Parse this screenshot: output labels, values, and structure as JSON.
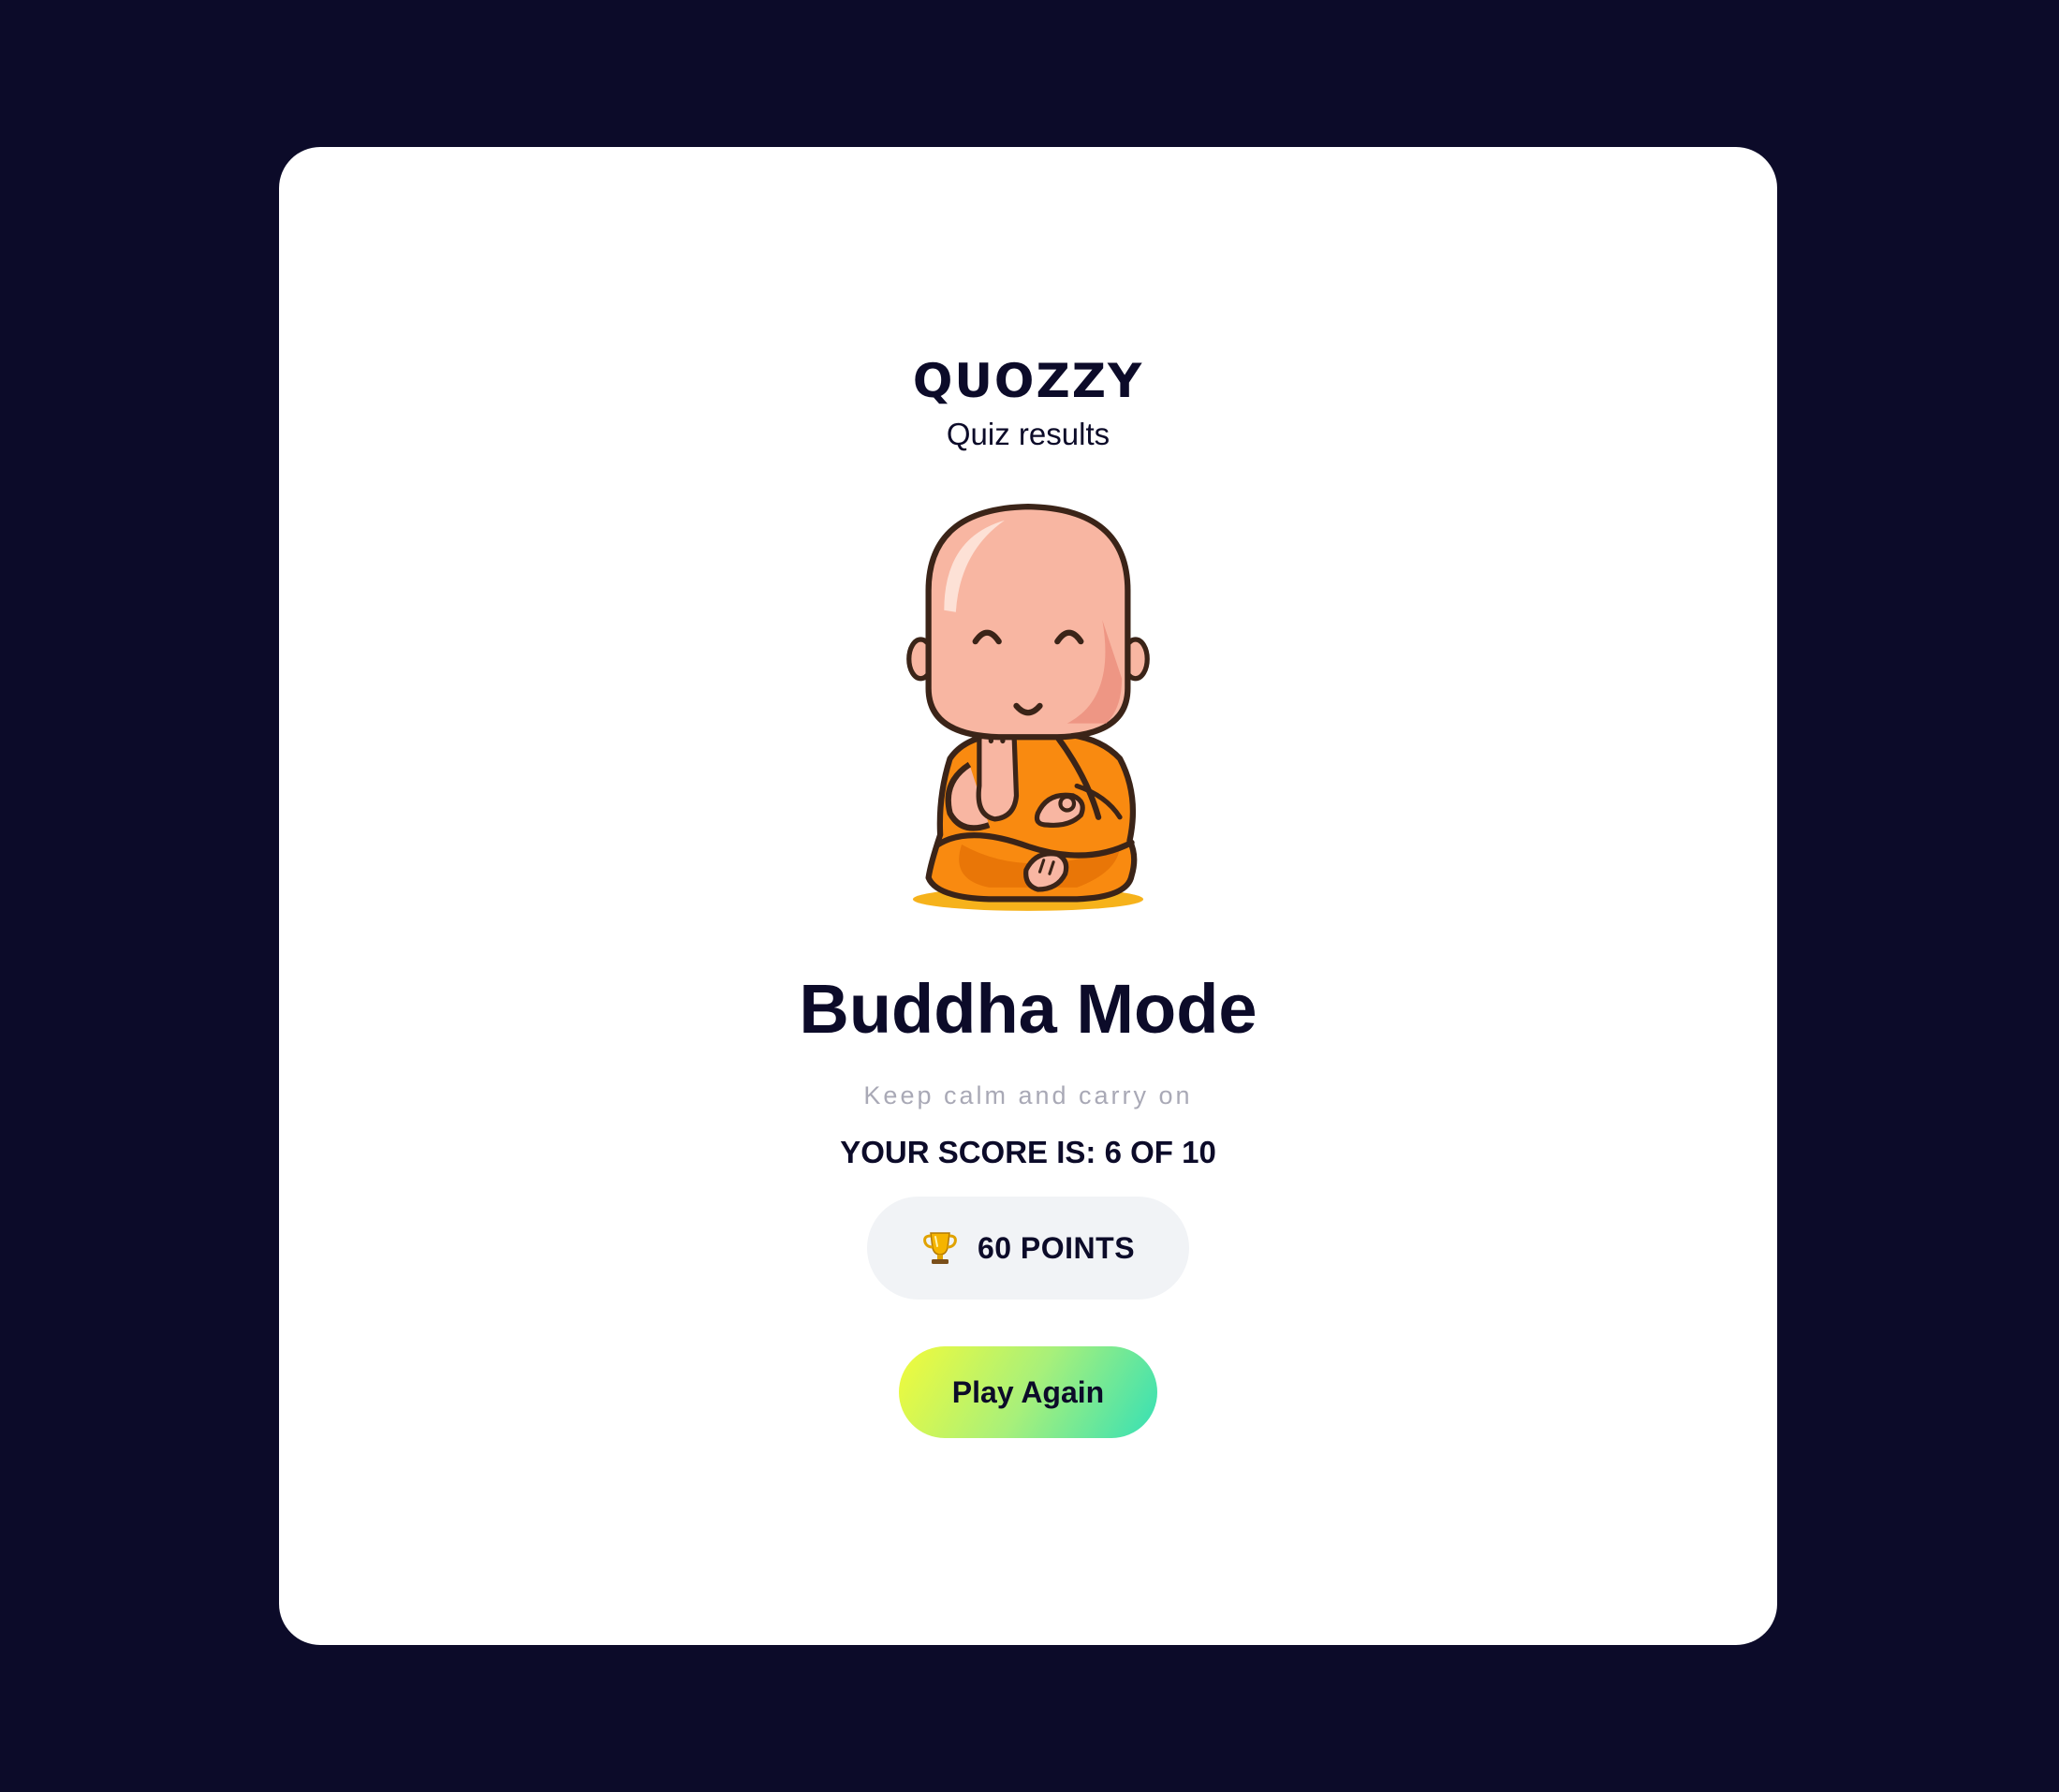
{
  "app": {
    "brand": "QUOZZY",
    "subtitle": "Quiz results"
  },
  "result": {
    "mascot_icon": "meditating-monk-icon",
    "title": "Buddha Mode",
    "tagline": "Keep calm and carry on",
    "score_text": "YOUR SCORE IS: 6 OF 10",
    "points_icon": "trophy-icon",
    "points_text": "60 POINTS"
  },
  "actions": {
    "play_again_label": "Play Again"
  },
  "colors": {
    "background": "#0c0b29",
    "card": "#ffffff",
    "text_primary": "#0c0b29",
    "text_muted": "#a9a9b6",
    "pill_bg": "#f1f3f6",
    "button_gradient_start": "#f2fb3a",
    "button_gradient_end": "#35e0b6",
    "robe": "#f98a10",
    "skin": "#f8b6a2"
  }
}
